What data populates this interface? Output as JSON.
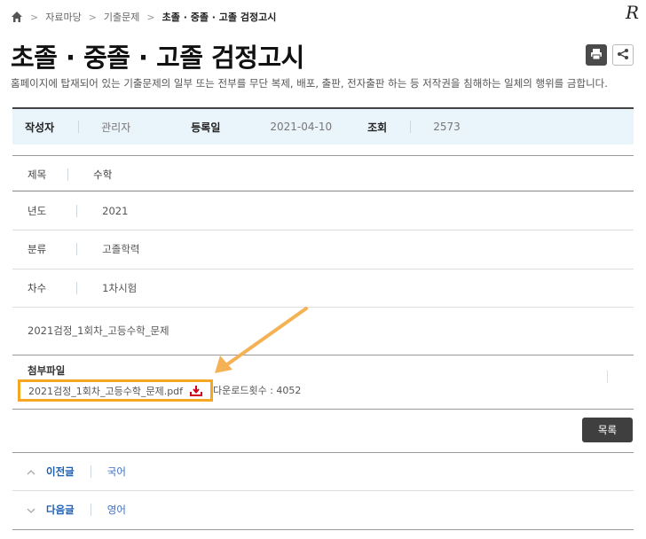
{
  "breadcrumb": {
    "items": [
      "자료마당",
      "기출문제"
    ],
    "current": "초졸 · 중졸 · 고졸 검정고시"
  },
  "logo_text": "R",
  "page_title": "초졸 · 중졸 · 고졸 검정고시",
  "notice": "홈페이지에 탑재되어 있는 기출문제의 일부 또는 전부를 무단 복제, 배포, 출판, 전자출판 하는 등 저작권을 침해하는 일체의 행위를 금합니다.",
  "meta": {
    "author_label": "작성자",
    "author": "관리자",
    "date_label": "등록일",
    "date": "2021-04-10",
    "views_label": "조회",
    "views": "2573"
  },
  "subject": {
    "label": "제목",
    "value": "수학"
  },
  "fields": [
    {
      "label": "년도",
      "value": "2021"
    },
    {
      "label": "분류",
      "value": "고졸학력"
    },
    {
      "label": "차수",
      "value": "1차시험"
    }
  ],
  "content": "2021검정_1회차_고등수학_문제",
  "attachment": {
    "label": "첨부파일",
    "file_name": "2021검정_1회차_고등수학_문제.pdf",
    "download_count": "다운로드횟수 : 4052"
  },
  "list_button": "목록",
  "prev": {
    "label": "이전글",
    "title": "국어"
  },
  "next": {
    "label": "다음글",
    "title": "영어"
  },
  "colors": {
    "highlight": "#f5a623",
    "meta_bg": "#eaf4fb",
    "link": "#1a5fb4",
    "download": "#d0021b"
  }
}
